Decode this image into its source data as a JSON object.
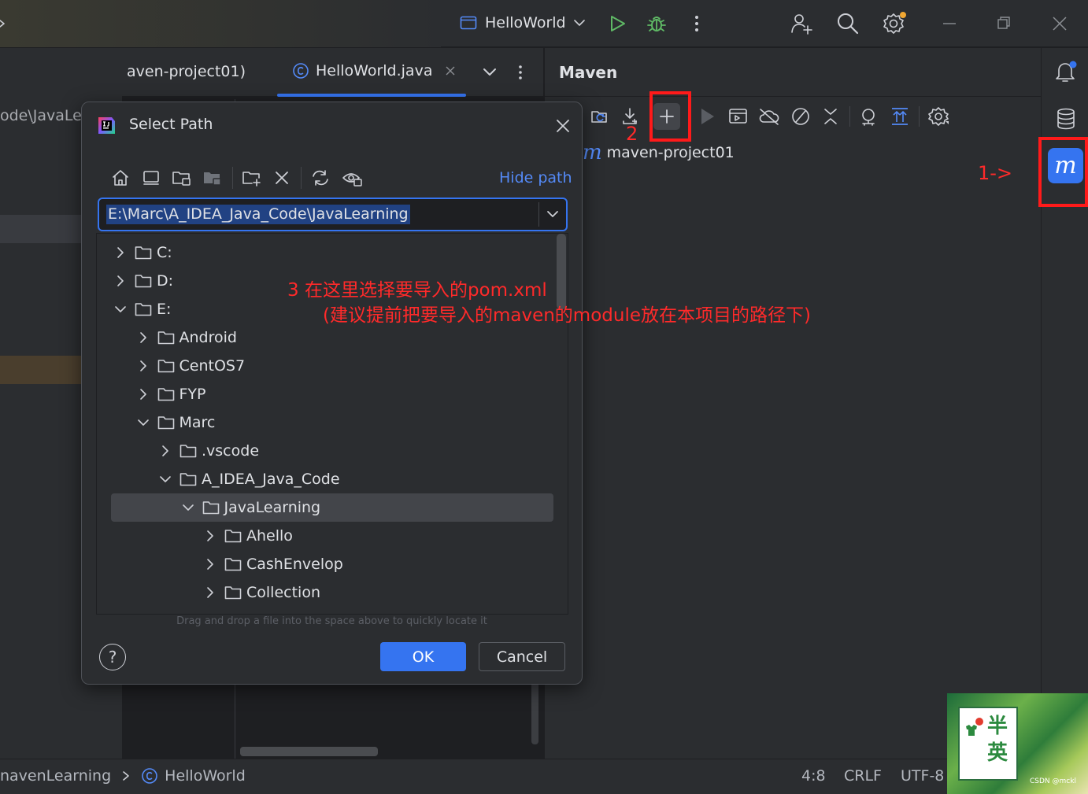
{
  "titlebar": {
    "run_config": "HelloWorld",
    "icons": [
      "run-config-icon",
      "chevron-down-icon",
      "run-icon",
      "debug-icon",
      "more-icon",
      "add-user-icon",
      "search-icon",
      "settings-icon",
      "minimize-icon",
      "restore-icon",
      "close-icon"
    ]
  },
  "editor": {
    "left_path_fragment": "ode\\JavaLe",
    "tabs": [
      {
        "label": "aven-project01)"
      },
      {
        "label": "HelloWorld.java",
        "active": true
      }
    ]
  },
  "maven": {
    "title": "Maven",
    "project_label": "maven-project01",
    "project_icon_glyph": "m",
    "toolbar_icons": [
      "reload-icon",
      "download-icon",
      "add-icon",
      "run-icon",
      "execute-goal-icon",
      "offline-icon",
      "skip-tests-icon",
      "collapse-icon",
      "show-dependencies-icon",
      "expand-icon",
      "settings-icon"
    ]
  },
  "right_strip": {
    "icons": [
      "notifications-icon",
      "database-icon",
      "maven-icon"
    ],
    "maven_glyph": "m"
  },
  "dialog": {
    "title": "Select Path",
    "hide_path_link": "Hide path",
    "path_value": "E:\\Marc\\A_IDEA_Java_Code\\JavaLearning",
    "hint": "Drag and drop a file into the space above to quickly locate it",
    "ok_label": "OK",
    "cancel_label": "Cancel",
    "help_label": "?",
    "toolbar_icons": [
      "home-icon",
      "desktop-icon",
      "project-folder-icon",
      "module-folder-icon",
      "new-folder-icon",
      "delete-icon",
      "refresh-icon",
      "show-hidden-icon"
    ],
    "tree": [
      {
        "label": "C:",
        "level": 0,
        "expanded": false
      },
      {
        "label": "D:",
        "level": 0,
        "expanded": false
      },
      {
        "label": "E:",
        "level": 0,
        "expanded": true
      },
      {
        "label": "Android",
        "level": 1,
        "expanded": false
      },
      {
        "label": "CentOS7",
        "level": 1,
        "expanded": false
      },
      {
        "label": "FYP",
        "level": 1,
        "expanded": false
      },
      {
        "label": "Marc",
        "level": 1,
        "expanded": true
      },
      {
        "label": ".vscode",
        "level": 2,
        "expanded": false
      },
      {
        "label": "A_IDEA_Java_Code",
        "level": 2,
        "expanded": true
      },
      {
        "label": "JavaLearning",
        "level": 3,
        "expanded": true,
        "selected": true
      },
      {
        "label": "Ahello",
        "level": 4,
        "expanded": false
      },
      {
        "label": "CashEnvelop",
        "level": 4,
        "expanded": false
      },
      {
        "label": "Collection",
        "level": 4,
        "expanded": false
      }
    ]
  },
  "annotations": {
    "step1": "1->",
    "step2": "2",
    "step3_line1": "3  在这里选择要导入的pom.xml",
    "step3_line2": "(建议提前把要导入的maven的module放在本项目的路径下)"
  },
  "statusbar": {
    "breadcrumb_left": "navenLearning",
    "breadcrumb_right": "HelloWorld",
    "position": "4:8",
    "line_ending": "CRLF",
    "encoding": "UTF-8"
  },
  "watermark": {
    "brand_text": "半 英",
    "credit": "CSDN @mckl"
  },
  "colors": {
    "accent": "#3574f0",
    "annotation_red": "#ff2a2a",
    "run_green": "#5fb865"
  }
}
